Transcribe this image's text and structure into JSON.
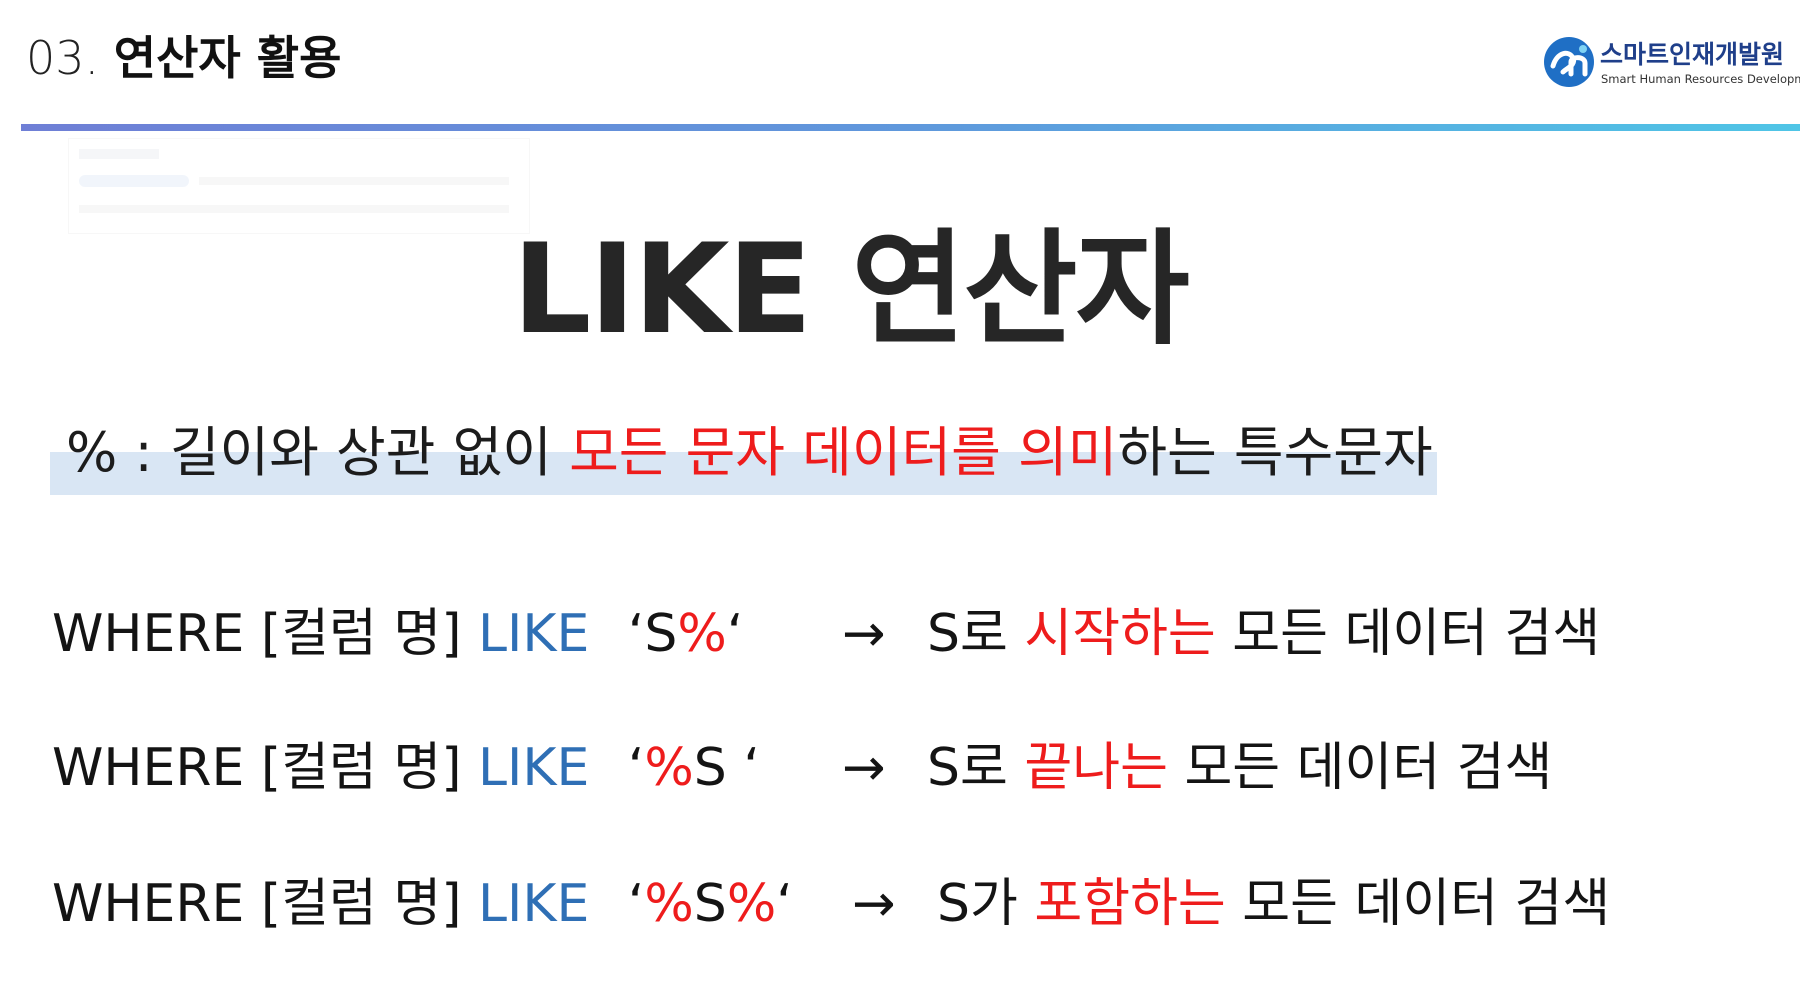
{
  "header": {
    "section_number": "03.",
    "section_title": "연산자 활용"
  },
  "logo": {
    "name": "스마트인재개발원",
    "subtitle": "Smart Human Resources Development"
  },
  "main_title": "LIKE 연산자",
  "definition": {
    "prefix": "% : 길이와 상관 없이 ",
    "emphasis": "모든 문자 데이터를 의미",
    "suffix": "하는 특수문자"
  },
  "rows": [
    {
      "where": "WHERE [컬럼 명] ",
      "like": "LIKE",
      "quote_open": "‘",
      "pre": "S",
      "pct_a": "%",
      "mid": "",
      "pct_b": "",
      "quote_close": "‘",
      "arrow": "→",
      "subject": "S로 ",
      "emphasis": "시작하는",
      "tail": " 모든 데이터 검색"
    },
    {
      "where": "WHERE [컬럼 명] ",
      "like": "LIKE",
      "quote_open": "‘",
      "pre": "",
      "pct_a": "%",
      "mid": "S ",
      "pct_b": "",
      "quote_close": "‘",
      "arrow": "→",
      "subject": "S로 ",
      "emphasis": "끝나는",
      "tail": " 모든 데이터 검색"
    },
    {
      "where": "WHERE [컬럼 명] ",
      "like": "LIKE",
      "quote_open": "‘",
      "pre": "",
      "pct_a": "%",
      "mid": "S",
      "pct_b": "%",
      "quote_close": "‘",
      "arrow": "→",
      "subject": "S가 ",
      "emphasis": "포함하는",
      "tail": " 모든 데이터 검색"
    }
  ],
  "colors": {
    "emphasis_red": "#ee1c1c",
    "like_blue": "#2f6fb5",
    "highlight": "#d9e6f4"
  }
}
